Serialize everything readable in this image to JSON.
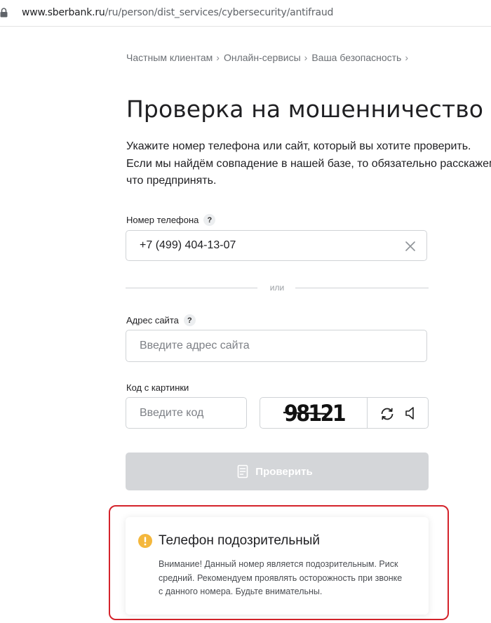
{
  "browser": {
    "url_host": "www.sberbank.ru",
    "url_path": "/ru/person/dist_services/cybersecurity/antifraud"
  },
  "breadcrumb": [
    "Частным клиентам",
    "Онлайн-сервисы",
    "Ваша безопасность"
  ],
  "page": {
    "title": "Проверка на мошенничество",
    "intro_lines": [
      "Укажите номер телефона или сайт, который вы хотите проверить.",
      "Если мы найдём совпадение в нашей базе, то обязательно расскажем",
      "что предпринять."
    ]
  },
  "form": {
    "phone_label": "Номер телефона",
    "phone_value": "+7 (499) 404-13-07",
    "help_mark": "?",
    "or_text": "или",
    "site_label": "Адрес сайта",
    "site_placeholder": "Введите адрес сайта",
    "site_value": "",
    "captcha_label": "Код с картинки",
    "captcha_placeholder": "Введите код",
    "captcha_value": "",
    "captcha_text": "98121",
    "submit_label": "Проверить",
    "submit_enabled": false
  },
  "result": {
    "status": "suspicious",
    "title": "Телефон подозрительный",
    "lines": [
      "Внимание! Данный номер является подозрительным. Риск",
      "средний. Рекомендуем проявлять осторожность при звонке",
      "с данного номера. Будьте внимательны."
    ],
    "icon": "warning-icon"
  },
  "colors": {
    "warning": "#f4b73c",
    "highlight": "#d4232b",
    "button_disabled": "#d4d6d9"
  }
}
